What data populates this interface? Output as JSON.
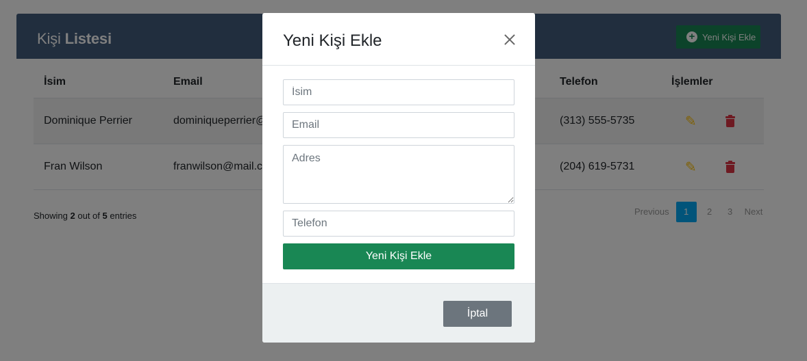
{
  "page": {
    "title_light": "Kişi",
    "title_bold": "Listesi",
    "add_button_label": "Yeni Kişi Ekle"
  },
  "table": {
    "headers": [
      "İsim",
      "Email",
      "Telefon",
      "İşlemler"
    ],
    "rows": [
      {
        "name": "Dominique Perrier",
        "email": "dominiqueperrier@",
        "phone": "(313) 555-5735"
      },
      {
        "name": "Fran Wilson",
        "email": "franwilson@mail.co",
        "phone": "(204) 619-5731"
      }
    ]
  },
  "footer": {
    "showing_prefix": "Showing",
    "shown_count": "2",
    "out_of": "out of",
    "total": "5",
    "entries": "entries"
  },
  "pagination": {
    "previous": "Previous",
    "pages": [
      "1",
      "2",
      "3"
    ],
    "current": "1",
    "next": "Next"
  },
  "modal": {
    "title": "Yeni Kişi Ekle",
    "name_placeholder": "İsim",
    "email_placeholder": "Email",
    "address_placeholder": "Adres",
    "phone_placeholder": "Telefon",
    "submit_label": "Yeni Kişi Ekle",
    "cancel_label": "İptal"
  },
  "colors": {
    "header_bg": "#435d7d",
    "success": "#198754",
    "secondary": "#6c757d",
    "edit": "#ffc107",
    "delete": "#dc3545",
    "page_active": "#03a9f4"
  }
}
